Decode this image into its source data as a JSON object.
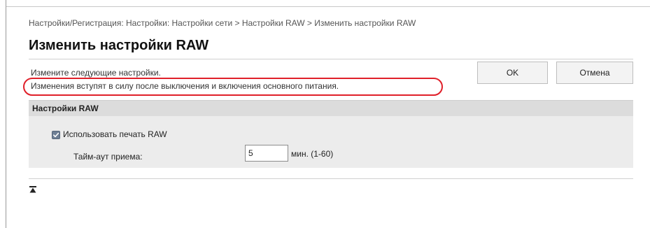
{
  "breadcrumb": "Настройки/Регистрация: Настройки: Настройки сети > Настройки RAW > Изменить настройки RAW",
  "page_title": "Изменить настройки RAW",
  "instruction": "Измените следующие настройки.",
  "notice": "Изменения вступят в силу после выключения и включения основного питания.",
  "buttons": {
    "ok": "OK",
    "cancel": "Отмена"
  },
  "section": {
    "title": "Настройки RAW",
    "use_raw_label": "Использовать печать RAW",
    "use_raw_checked": true,
    "timeout_label": "Тайм-аут приема:",
    "timeout_value": "5",
    "timeout_unit": "мин. (1-60)"
  },
  "icons": {
    "checkbox": "checkmark-icon",
    "page_top": "page-top-icon"
  },
  "colors": {
    "highlight": "#e0202a",
    "section_bg": "#ececec",
    "section_header_bg": "#dcdcdc"
  }
}
